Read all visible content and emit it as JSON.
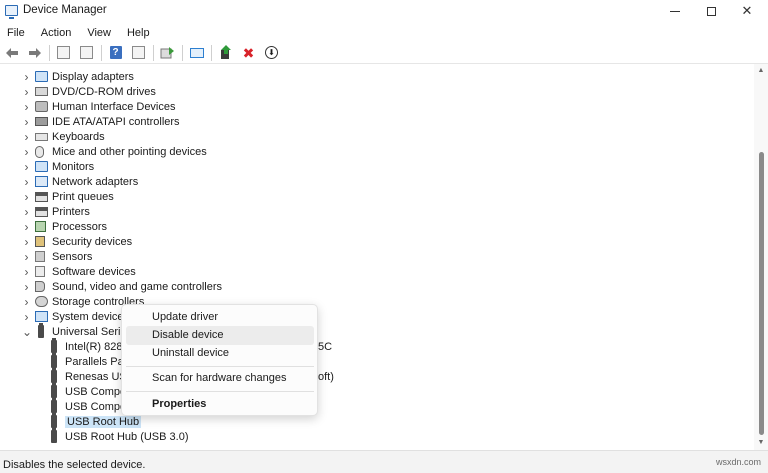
{
  "window": {
    "title": "Device Manager",
    "minimize_glyph": "—",
    "maximize_glyph": "☐",
    "close_glyph": "✕"
  },
  "menu": [
    "File",
    "Action",
    "View",
    "Help"
  ],
  "toolbar": {
    "icons": [
      "back-arrow-icon",
      "forward-arrow-icon",
      "properties-icon",
      "view-icon",
      "help-icon",
      "view-list-icon",
      "update-driver-icon",
      "scan-hardware-icon",
      "add-driver-icon",
      "uninstall-icon",
      "download-icon"
    ]
  },
  "tree": {
    "categories": [
      {
        "label": "Display adapters",
        "icon": "monitor"
      },
      {
        "label": "DVD/CD-ROM drives",
        "icon": "drive"
      },
      {
        "label": "Human Interface Devices",
        "icon": "hid"
      },
      {
        "label": "IDE ATA/ATAPI controllers",
        "icon": "ide"
      },
      {
        "label": "Keyboards",
        "icon": "kbd"
      },
      {
        "label": "Mice and other pointing devices",
        "icon": "mouse"
      },
      {
        "label": "Monitors",
        "icon": "monitor"
      },
      {
        "label": "Network adapters",
        "icon": "net"
      },
      {
        "label": "Print queues",
        "icon": "printer"
      },
      {
        "label": "Printers",
        "icon": "printer"
      },
      {
        "label": "Processors",
        "icon": "cpu"
      },
      {
        "label": "Security devices",
        "icon": "security"
      },
      {
        "label": "Sensors",
        "icon": "sensor"
      },
      {
        "label": "Software devices",
        "icon": "software"
      },
      {
        "label": "Sound, video and game controllers",
        "icon": "sound"
      },
      {
        "label": "Storage controllers",
        "icon": "storage"
      },
      {
        "label": "System devices",
        "icon": "system"
      }
    ],
    "expanded": {
      "label": "Universal Serial",
      "children": [
        {
          "label": "Intel(R) 8280",
          "trailing": "5C"
        },
        {
          "label": "Parallels Pa",
          "trailing": ""
        },
        {
          "label": "Renesas USE",
          "trailing": "oft)"
        },
        {
          "label": "USB Compo",
          "trailing": ""
        },
        {
          "label": "USB Compo",
          "trailing": ""
        },
        {
          "label": "USB Root Hub",
          "trailing": "",
          "selected": true
        },
        {
          "label": "USB Root Hub (USB 3.0)",
          "trailing": ""
        }
      ]
    }
  },
  "context_menu": {
    "items": [
      "Update driver",
      "Disable device",
      "Uninstall device",
      "Scan for hardware changes",
      "Properties"
    ],
    "hovered": "Disable device"
  },
  "status": {
    "text": "Disables the selected device."
  },
  "watermark": "wsxdn.com",
  "colors": {
    "selection": "#cce4f7",
    "accent": "#2b6bb5",
    "delete_red": "#d8232a"
  }
}
